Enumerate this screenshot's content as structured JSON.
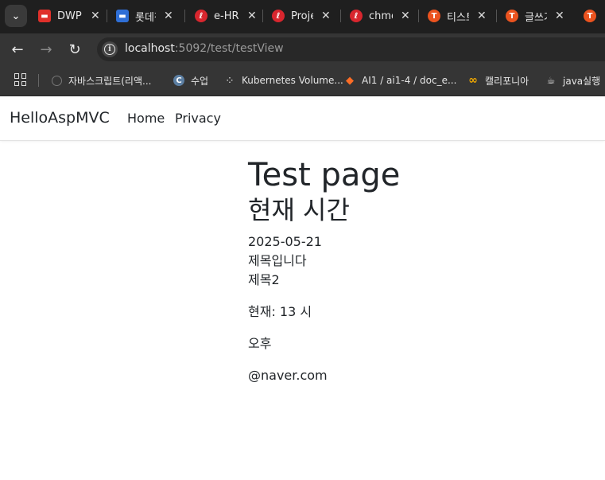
{
  "tabs": [
    {
      "title": "DWP",
      "favicon_text": "▬",
      "favicon_color": "#e0302a"
    },
    {
      "title": "롯데정보",
      "favicon_text": "▬",
      "favicon_color": "#2f6fd6"
    },
    {
      "title": "e-HR",
      "favicon_text": "ℓ",
      "favicon_color": "#d8262e"
    },
    {
      "title": "Project",
      "favicon_text": "ℓ",
      "favicon_color": "#d8262e"
    },
    {
      "title": "chmod",
      "favicon_text": "ℓ",
      "favicon_color": "#d8262e"
    },
    {
      "title": "티스토리",
      "favicon_text": "T",
      "favicon_color": "#eb531f"
    },
    {
      "title": "글쓰기",
      "favicon_text": "T",
      "favicon_color": "#eb531f"
    },
    {
      "title": "",
      "favicon_text": "T",
      "favicon_color": "#eb531f"
    }
  ],
  "address": {
    "host": "localhost",
    "path": ":5092/test/testView"
  },
  "bookmarks": [
    {
      "label": "자바스크립트(리액...",
      "icon": "circle-outline-icon"
    },
    {
      "label": "수업",
      "icon": "c-logo-icon"
    },
    {
      "label": "Kubernetes Volume...",
      "icon": "kubernetes-icon"
    },
    {
      "label": "AI1 / ai1-4 / doc_e...",
      "icon": "gitlab-icon"
    },
    {
      "label": "캘리포니아",
      "icon": "infinity-icon"
    },
    {
      "label": "java실행",
      "icon": "java-icon"
    }
  ],
  "page": {
    "brand": "HelloAspMVC",
    "nav": [
      "Home",
      "Privacy"
    ],
    "heading": "Test page",
    "subheading": "현재 시간",
    "date": "2025-05-21",
    "title1": "제목입니다",
    "title2": "제목2",
    "current_hour": "현재: 13 시",
    "period": "오후",
    "email": "@naver.com"
  }
}
